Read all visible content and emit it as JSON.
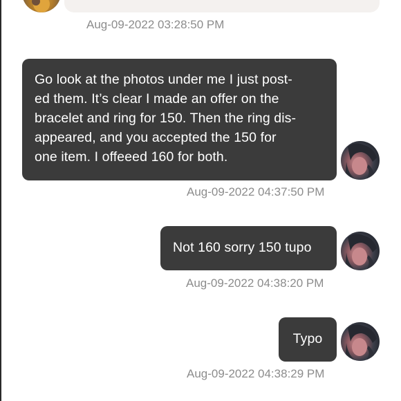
{
  "messages": [
    {
      "side": "received",
      "text": "",
      "timestamp": "Aug-09-2022 03:28:50 PM"
    },
    {
      "side": "sent",
      "text": "Go look at the photos under me I just post-\ned them. It’s clear I made an offer on the\nbracelet and ring for 150. Then the ring dis-\nappeared, and you accepted the 150 for\none item. I offeeed 160 for both.",
      "timestamp": "Aug-09-2022 04:37:50 PM"
    },
    {
      "side": "sent",
      "text": "Not 160 sorry 150 tupo",
      "timestamp": "Aug-09-2022 04:38:20 PM"
    },
    {
      "side": "sent",
      "text": "Typo",
      "timestamp": "Aug-09-2022 04:38:29 PM"
    }
  ],
  "colors": {
    "sent_bubble": "#3b3b3b",
    "received_bubble": "#f4f1ef",
    "timestamp": "#8c8c8c"
  }
}
